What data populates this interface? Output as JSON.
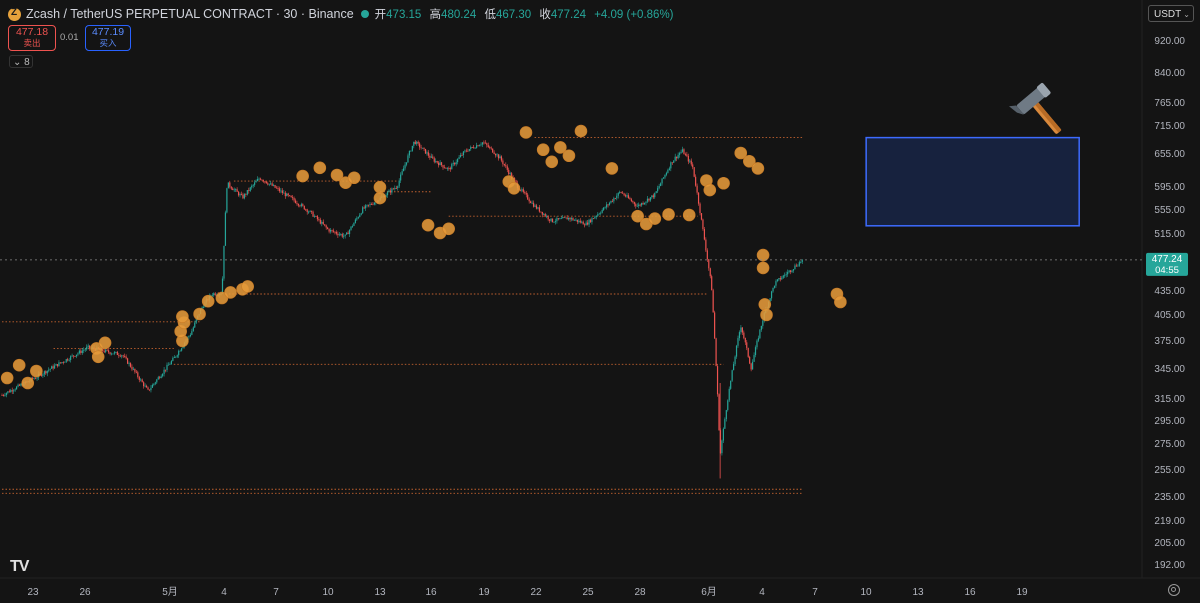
{
  "header": {
    "title": "Zcash / TetherUS PERPETUAL CONTRACT · 30 · Binance",
    "ohlc": [
      {
        "k": "开",
        "v": "473.15"
      },
      {
        "k": "高",
        "v": "480.24"
      },
      {
        "k": "低",
        "v": "467.30"
      },
      {
        "k": "收",
        "v": "477.24"
      },
      {
        "k": "",
        "v": "+4.09 (+0.86%)"
      }
    ]
  },
  "order": {
    "sell_price": "477.18",
    "sell_label": "卖出",
    "spread": "0.01",
    "buy_price": "477.19",
    "buy_label": "买入"
  },
  "indicator_count": "8",
  "currency": "USDT",
  "logo_text": "TV",
  "colors": {
    "up": "#26a69a",
    "down": "#ef5350",
    "marker": "#e59a3a",
    "level": "#c2612f",
    "zone_border": "#2962ff"
  },
  "chart_data": {
    "type": "candlestick",
    "y_ticks": [
      "920.00",
      "840.00",
      "765.00",
      "715.00",
      "655.00",
      "595.00",
      "555.00",
      "515.00",
      "435.00",
      "405.00",
      "375.00",
      "345.00",
      "315.00",
      "295.00",
      "275.00",
      "255.00",
      "235.00",
      "219.00",
      "205.00",
      "192.00"
    ],
    "x_ticks": [
      "23",
      "26",
      "5月",
      "4",
      "7",
      "10",
      "13",
      "16",
      "19",
      "22",
      "25",
      "28",
      "6月",
      "4",
      "7",
      "10",
      "13",
      "16",
      "19"
    ],
    "current_price": "477.24",
    "countdown": "04:55",
    "price_path": [
      {
        "t": 0,
        "p": 318
      },
      {
        "t": 2,
        "p": 336
      },
      {
        "t": 5,
        "p": 367
      },
      {
        "t": 7,
        "p": 359
      },
      {
        "t": 8.5,
        "p": 322
      },
      {
        "t": 10,
        "p": 355
      },
      {
        "t": 11,
        "p": 383
      },
      {
        "t": 11.6,
        "p": 412
      },
      {
        "t": 12.2,
        "p": 430
      },
      {
        "t": 12.8,
        "p": 432
      },
      {
        "t": 13.1,
        "p": 600
      },
      {
        "t": 14,
        "p": 575
      },
      {
        "t": 15,
        "p": 610
      },
      {
        "t": 16,
        "p": 590
      },
      {
        "t": 17,
        "p": 570
      },
      {
        "t": 18,
        "p": 548
      },
      {
        "t": 19,
        "p": 520
      },
      {
        "t": 20,
        "p": 510
      },
      {
        "t": 21,
        "p": 555
      },
      {
        "t": 22,
        "p": 573
      },
      {
        "t": 23,
        "p": 595
      },
      {
        "t": 24,
        "p": 680
      },
      {
        "t": 25,
        "p": 645
      },
      {
        "t": 26,
        "p": 625
      },
      {
        "t": 27,
        "p": 660
      },
      {
        "t": 28,
        "p": 678
      },
      {
        "t": 29,
        "p": 645
      },
      {
        "t": 30,
        "p": 595
      },
      {
        "t": 31,
        "p": 560
      },
      {
        "t": 32,
        "p": 535
      },
      {
        "t": 33,
        "p": 540
      },
      {
        "t": 34,
        "p": 530
      },
      {
        "t": 35,
        "p": 555
      },
      {
        "t": 36,
        "p": 585
      },
      {
        "t": 37,
        "p": 560
      },
      {
        "t": 38,
        "p": 580
      },
      {
        "t": 39,
        "p": 640
      },
      {
        "t": 39.6,
        "p": 660
      },
      {
        "t": 40.2,
        "p": 630
      },
      {
        "t": 40.8,
        "p": 520
      },
      {
        "t": 41.3,
        "p": 440
      },
      {
        "t": 41.8,
        "p": 265
      },
      {
        "t": 42.2,
        "p": 310
      },
      {
        "t": 43,
        "p": 392
      },
      {
        "t": 43.6,
        "p": 345
      },
      {
        "t": 44.3,
        "p": 400
      },
      {
        "t": 45,
        "p": 445
      },
      {
        "t": 46,
        "p": 465
      },
      {
        "t": 46.6,
        "p": 477.24
      }
    ],
    "horizontal_levels": [
      {
        "price": 688,
        "t_start": 31,
        "t_end": 46.6
      },
      {
        "price": 604,
        "t_start": 13.5,
        "t_end": 23
      },
      {
        "price": 585,
        "t_start": 22,
        "t_end": 25
      },
      {
        "price": 543,
        "t_start": 26,
        "t_end": 40.5
      },
      {
        "price": 430,
        "t_start": 13,
        "t_end": 41
      },
      {
        "price": 396,
        "t_start": 0,
        "t_end": 11.5
      },
      {
        "price": 366,
        "t_start": 3,
        "t_end": 10
      },
      {
        "price": 349,
        "t_start": 10,
        "t_end": 42
      },
      {
        "price": 240,
        "t_start": 0,
        "t_end": 46.6
      },
      {
        "price": 237,
        "t_start": 0,
        "t_end": 46.6
      }
    ],
    "trade_markers": [
      {
        "t": 0.3,
        "p": 335
      },
      {
        "t": 1,
        "p": 348
      },
      {
        "t": 1.5,
        "p": 330
      },
      {
        "t": 2,
        "p": 342
      },
      {
        "t": 5.5,
        "p": 366
      },
      {
        "t": 6,
        "p": 372
      },
      {
        "t": 5.6,
        "p": 357
      },
      {
        "t": 10.5,
        "p": 374
      },
      {
        "t": 10.4,
        "p": 385
      },
      {
        "t": 10.6,
        "p": 395
      },
      {
        "t": 10.5,
        "p": 402
      },
      {
        "t": 11.5,
        "p": 405
      },
      {
        "t": 12,
        "p": 421
      },
      {
        "t": 12.8,
        "p": 425
      },
      {
        "t": 13.3,
        "p": 432
      },
      {
        "t": 14,
        "p": 436
      },
      {
        "t": 14.3,
        "p": 440
      },
      {
        "t": 17.5,
        "p": 613
      },
      {
        "t": 18.5,
        "p": 628
      },
      {
        "t": 19.5,
        "p": 615
      },
      {
        "t": 20,
        "p": 601
      },
      {
        "t": 20.5,
        "p": 610
      },
      {
        "t": 22,
        "p": 593
      },
      {
        "t": 22,
        "p": 574
      },
      {
        "t": 24.8,
        "p": 528
      },
      {
        "t": 25.5,
        "p": 515
      },
      {
        "t": 26,
        "p": 522
      },
      {
        "t": 29.5,
        "p": 603
      },
      {
        "t": 29.8,
        "p": 591
      },
      {
        "t": 30.5,
        "p": 699
      },
      {
        "t": 31.5,
        "p": 662
      },
      {
        "t": 32,
        "p": 639
      },
      {
        "t": 32.5,
        "p": 667
      },
      {
        "t": 33,
        "p": 650
      },
      {
        "t": 33.7,
        "p": 702
      },
      {
        "t": 35.5,
        "p": 627
      },
      {
        "t": 37,
        "p": 543
      },
      {
        "t": 37.5,
        "p": 530
      },
      {
        "t": 38,
        "p": 539
      },
      {
        "t": 38.8,
        "p": 546
      },
      {
        "t": 40,
        "p": 545
      },
      {
        "t": 41,
        "p": 605
      },
      {
        "t": 41.2,
        "p": 588
      },
      {
        "t": 42,
        "p": 600
      },
      {
        "t": 43,
        "p": 655
      },
      {
        "t": 43.5,
        "p": 640
      },
      {
        "t": 44,
        "p": 627
      },
      {
        "t": 44.3,
        "p": 484
      },
      {
        "t": 44.3,
        "p": 466
      },
      {
        "t": 44.4,
        "p": 417
      },
      {
        "t": 44.5,
        "p": 404
      },
      {
        "t": 48.6,
        "p": 430
      },
      {
        "t": 48.8,
        "p": 420
      }
    ],
    "target_zone": {
      "price_top": 688,
      "price_bottom": 527,
      "t_start": 50.3,
      "t_end": 62.7
    },
    "hammer_icon": "hammer-icon",
    "grid": false
  }
}
